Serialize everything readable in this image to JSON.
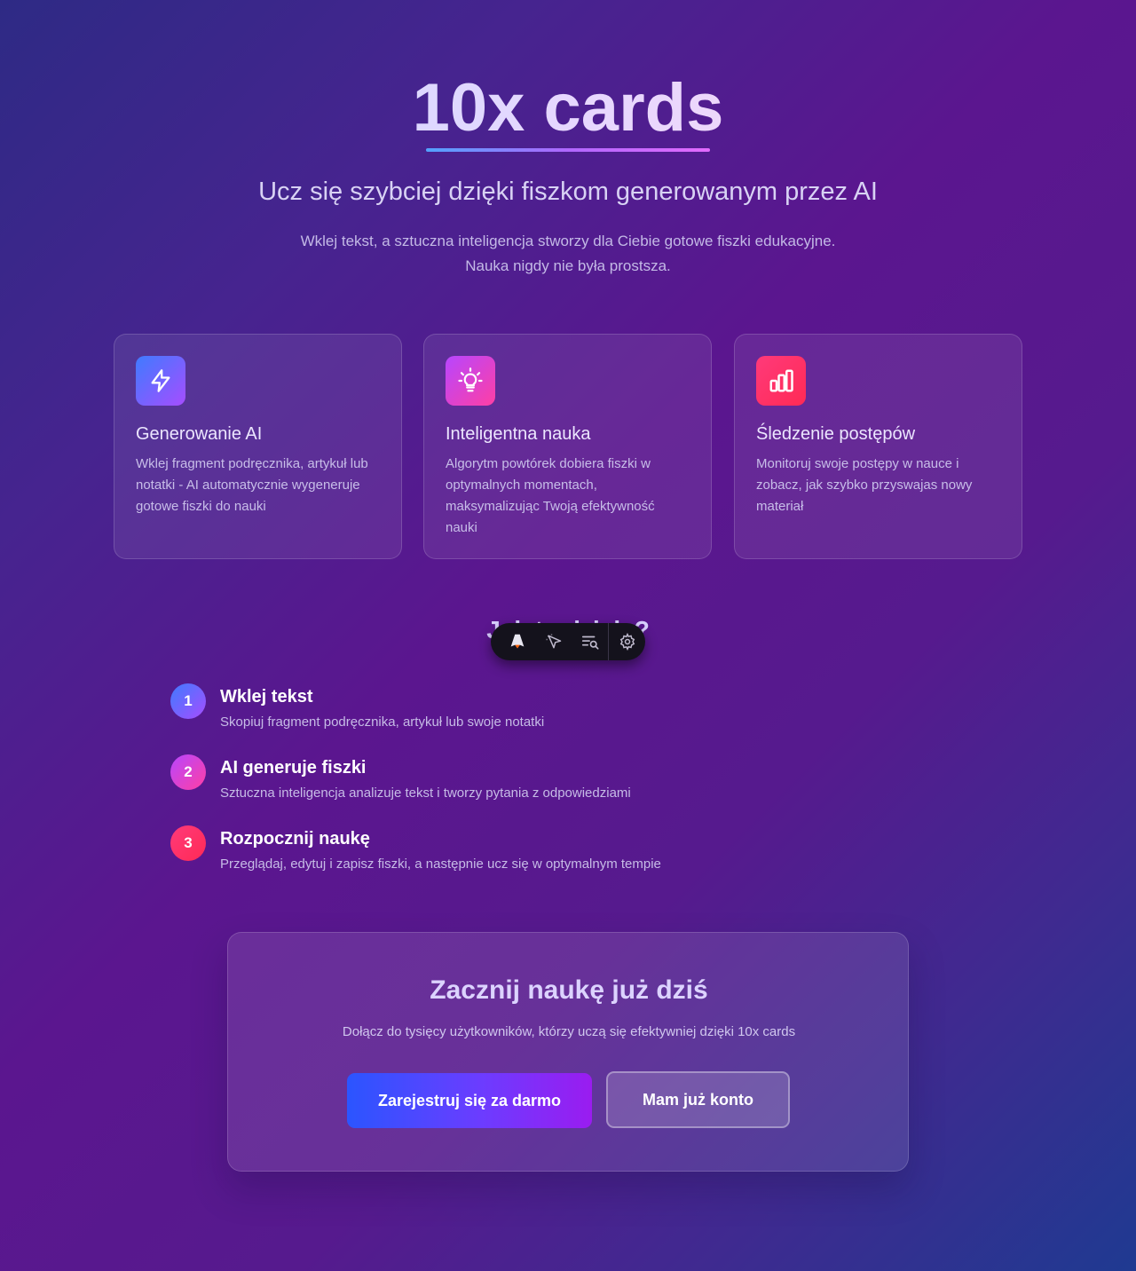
{
  "hero": {
    "title": "10x cards",
    "subtitle": "Ucz się szybciej dzięki fiszkom generowanym przez AI",
    "lead_line1": "Wklej tekst, a sztuczna inteligencja stworzy dla Ciebie gotowe fiszki edukacyjne.",
    "lead_line2": "Nauka nigdy nie była prostsza."
  },
  "features": [
    {
      "icon": "lightning-icon",
      "title": "Generowanie AI",
      "description": "Wklej fragment podręcznika, artykuł lub notatki - AI automatycznie wygeneruje gotowe fiszki do nauki",
      "color_from": "#3f7bff",
      "color_to": "#a64dff"
    },
    {
      "icon": "lightbulb-icon",
      "title": "Inteligentna nauka",
      "description": "Algorytm powtórek dobiera fiszki w optymalnych momentach, maksymalizując Twoją efektywność nauki",
      "color_from": "#b746ff",
      "color_to": "#ff3fa4"
    },
    {
      "icon": "bar-chart-icon",
      "title": "Śledzenie postępów",
      "description": "Monitoruj swoje postępy w nauce i zobacz, jak szybko przyswajas nowy materiał",
      "color_from": "#ff3a7a",
      "color_to": "#ff2a55"
    }
  ],
  "how_it_works": {
    "heading": "Jak to działa?",
    "steps": [
      {
        "number": "1",
        "title": "Wklej tekst",
        "description": "Skopiuj fragment podręcznika, artykuł lub swoje notatki"
      },
      {
        "number": "2",
        "title": "AI generuje fiszki",
        "description": "Sztuczna inteligencja analizuje tekst i tworzy pytania z odpowiedziami"
      },
      {
        "number": "3",
        "title": "Rozpocznij naukę",
        "description": "Przeglądaj, edytuj i zapisz fiszki, a następnie ucz się w optymalnym tempie"
      }
    ]
  },
  "toolbar": {
    "icons": [
      "astro-logo-icon",
      "cursor-select-icon",
      "list-search-icon",
      "gear-icon"
    ]
  },
  "cta": {
    "title": "Zacznij naukę już dziś",
    "description": "Dołącz do tysięcy użytkowników, którzy uczą się efektywniej dzięki 10x cards",
    "primary_label": "Zarejestruj się za darmo",
    "secondary_label": "Mam już konto"
  }
}
